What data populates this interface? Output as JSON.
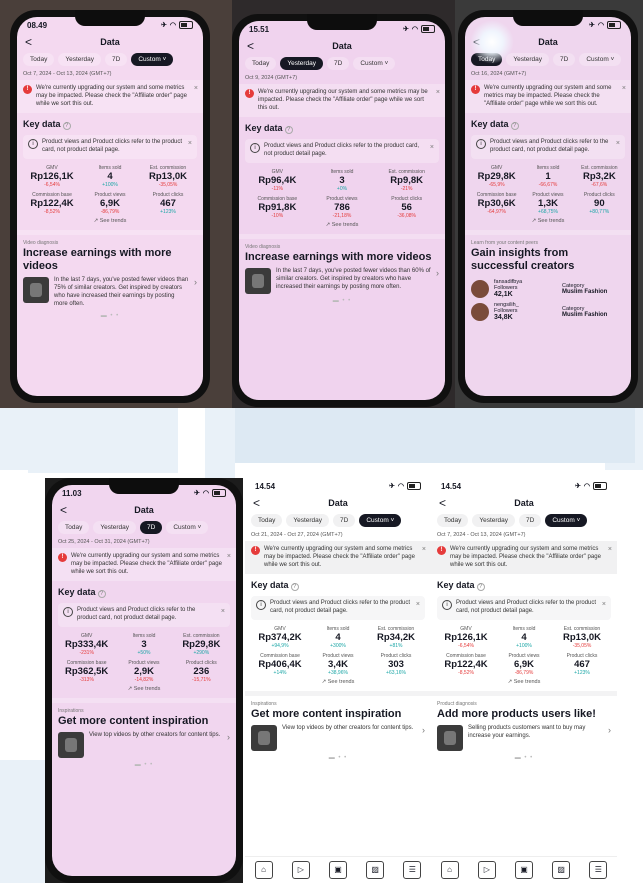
{
  "common": {
    "title": "Data",
    "back": "<",
    "tabs": [
      "Today",
      "Yesterday",
      "7D",
      "Custom ˅"
    ],
    "banner": "We're currently upgrading our system and some metrics may be impacted. Please check the \"Affiliate order\" page while we sort this out.",
    "key_data": "Key data",
    "note": "Product views and Product clicks refer to the product card, not product detail page.",
    "labels": [
      "GMV",
      "Items sold",
      "Est. commission",
      "Commission base",
      "Product views",
      "Product clicks"
    ],
    "see_trends": "See trends",
    "close": "×"
  },
  "screens": [
    {
      "time": "08.49",
      "active_tab": 3,
      "date": "Oct 7, 2024 - Oct 13, 2024 (GMT+7)",
      "values": [
        "Rp126,1K",
        "4",
        "Rp13,0K",
        "Rp122,4K",
        "6,9K",
        "467"
      ],
      "changes": [
        "-6,54%",
        "+100%",
        "-35,05%",
        "-8,52%",
        "-86,79%",
        "+123%"
      ],
      "neg": [
        true,
        false,
        true,
        true,
        true,
        false
      ],
      "section_label": "Video diagnosis",
      "section_title": "Increase earnings with more videos",
      "section_text": "In the last 7 days, you've posted fewer videos than 75% of similar creators. Get inspired by creators who have increased their earnings by posting more often."
    },
    {
      "time": "15.51",
      "active_tab": 1,
      "date": "Oct 9, 2024 (GMT+7)",
      "values": [
        "Rp96,4K",
        "3",
        "Rp9,8K",
        "Rp91,8K",
        "786",
        "56"
      ],
      "changes": [
        "-11%",
        "+0%",
        "-21%",
        "-10%",
        "-21,18%",
        "-36,08%"
      ],
      "neg": [
        true,
        false,
        true,
        true,
        true,
        true
      ],
      "section_label": "Video diagnosis",
      "section_title": "Increase earnings with more videos",
      "section_text": "In the last 7 days, you've posted fewer videos than 60% of similar creators. Get inspired by creators who have increased their earnings by posting more often."
    },
    {
      "time": "",
      "active_tab": 0,
      "date": "Oct 16, 2024 (GMT+7)",
      "values": [
        "Rp29,8K",
        "1",
        "Rp3,2K",
        "Rp30,6K",
        "1,3K",
        "90"
      ],
      "changes": [
        "-65,9%",
        "-66,67%",
        "-67,6%",
        "-64,97%",
        "+68,75%",
        "+80,77%"
      ],
      "neg": [
        true,
        true,
        true,
        true,
        false,
        false
      ],
      "section_label": "Learn from your content peers",
      "section_title": "Gain insights from successful creators",
      "creators": [
        {
          "name": "fansadifbya",
          "followers_label": "Followers",
          "followers": "42,1K",
          "category_label": "Category",
          "category": "Muslim Fashion"
        },
        {
          "name": "nengsilih_",
          "followers_label": "Followers",
          "followers": "34,8K",
          "category_label": "Category",
          "category": "Muslim Fashion"
        }
      ]
    },
    {
      "time": "11.03",
      "active_tab": 2,
      "date": "Oct 25, 2024 - Oct 31, 2024 (GMT+7)",
      "values": [
        "Rp333,4K",
        "3",
        "Rp29,8K",
        "Rp362,5K",
        "2,9K",
        "236"
      ],
      "changes": [
        "-231%",
        "+50%",
        "+290%",
        "-313%",
        "-14,82%",
        "-15,71%"
      ],
      "neg": [
        true,
        false,
        false,
        true,
        true,
        true
      ],
      "section_label": "Inspirations",
      "section_title": "Get more content inspiration",
      "section_text": "View top videos by other creators for content tips."
    },
    {
      "time": "14.54",
      "active_tab": 3,
      "date": "Oct 21, 2024 - Oct 27, 2024 (GMT+7)",
      "values": [
        "Rp374,2K",
        "4",
        "Rp34,2K",
        "Rp406,4K",
        "3,4K",
        "303"
      ],
      "changes": [
        "+94,9%",
        "+300%",
        "+81%",
        "+14%",
        "+38,96%",
        "+63,16%"
      ],
      "neg": [
        false,
        false,
        false,
        false,
        false,
        false
      ],
      "section_label": "Inspirations",
      "section_title": "Get more content inspiration",
      "section_text": "View top videos by other creators for content tips."
    },
    {
      "time": "14.54",
      "active_tab": 3,
      "date": "Oct 7, 2024 - Oct 13, 2024 (GMT+7)",
      "values": [
        "Rp126,1K",
        "4",
        "Rp13,0K",
        "Rp122,4K",
        "6,9K",
        "467"
      ],
      "changes": [
        "-6,54%",
        "+100%",
        "-35,05%",
        "-8,52%",
        "-86,79%",
        "+123%"
      ],
      "neg": [
        true,
        false,
        true,
        true,
        true,
        false
      ],
      "section_label": "Product diagnosis",
      "section_title": "Add more products users like!",
      "section_text": "Selling products customers want to buy may increase your earnings."
    }
  ],
  "colors": {
    "accent_pos": "#1aa6a6",
    "accent_neg": "#e53b3b",
    "tab_active": "#161823"
  },
  "icons": [
    "back-icon",
    "warning-icon",
    "info-icon",
    "close-icon",
    "trend-icon",
    "chevron-right-icon",
    "wifi-icon",
    "airplane-icon",
    "battery-icon"
  ]
}
